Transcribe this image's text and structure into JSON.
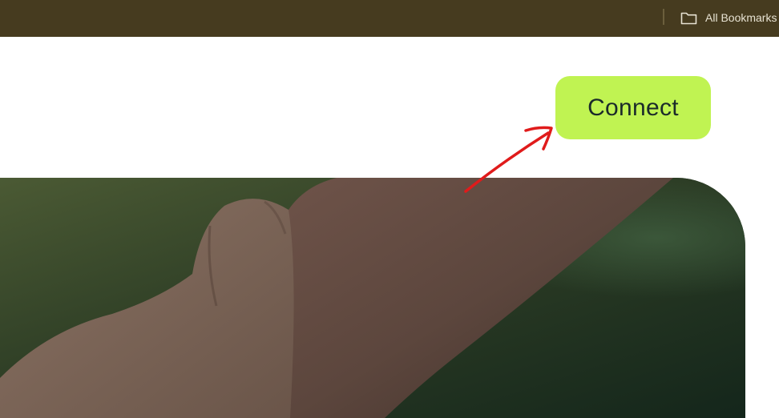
{
  "bookmarks_bar": {
    "folder_label": "All Bookmarks",
    "folder_icon": "folder-icon"
  },
  "header": {
    "connect_label": "Connect"
  },
  "annotation": {
    "arrow_icon": "annotation-arrow-icon",
    "arrow_color": "#e01b1b"
  },
  "colors": {
    "bookmarks_bar_bg": "#463b1f",
    "connect_button_bg": "#c0f352",
    "connect_button_text": "#1b2a2a"
  }
}
